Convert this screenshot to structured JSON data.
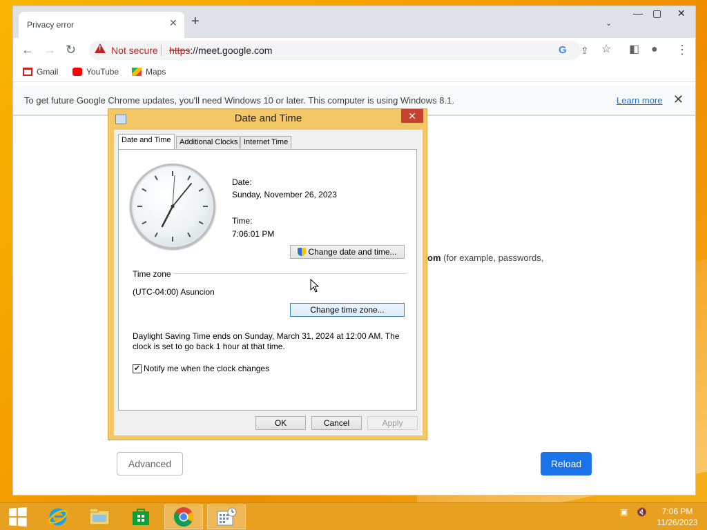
{
  "browser": {
    "tab_title": "Privacy error",
    "new_tab_symbol": "+",
    "security_label": "Not secure",
    "url_scheme": "https",
    "url_rest": "://meet.google.com",
    "bookmarks": [
      {
        "label": "Gmail",
        "icon": "gmail-icon"
      },
      {
        "label": "YouTube",
        "icon": "youtube-icon"
      },
      {
        "label": "Maps",
        "icon": "maps-icon"
      }
    ],
    "infobar_text": "To get future Google Chrome updates, you'll need Windows 10 or later. This computer is using Windows 8.1.",
    "infobar_link": "Learn more"
  },
  "page": {
    "text_bold": "om",
    "text_rest": " (for example, passwords,",
    "advanced_label": "Advanced",
    "reload_label": "Reload",
    "accent": "#1a73e8"
  },
  "dialog": {
    "title": "Date and Time",
    "tabs": [
      "Date and Time",
      "Additional Clocks",
      "Internet Time"
    ],
    "date_label": "Date:",
    "date_value": "Sunday, November 26, 2023",
    "time_label": "Time:",
    "time_value": "7:06:01 PM",
    "change_datetime_btn": "Change date and time...",
    "timezone_heading": "Time zone",
    "timezone_value": "(UTC-04:00) Asuncion",
    "change_timezone_btn": "Change time zone...",
    "dst_text": "Daylight Saving Time ends on Sunday, March 31, 2024 at 12:00 AM. The clock is set to go back 1 hour at that time.",
    "notify_label": "Notify me when the clock changes",
    "notify_checked": true,
    "ok_label": "OK",
    "cancel_label": "Cancel",
    "apply_label": "Apply"
  },
  "taskbar": {
    "time": "7:06 PM",
    "date": "11/26/2023"
  }
}
